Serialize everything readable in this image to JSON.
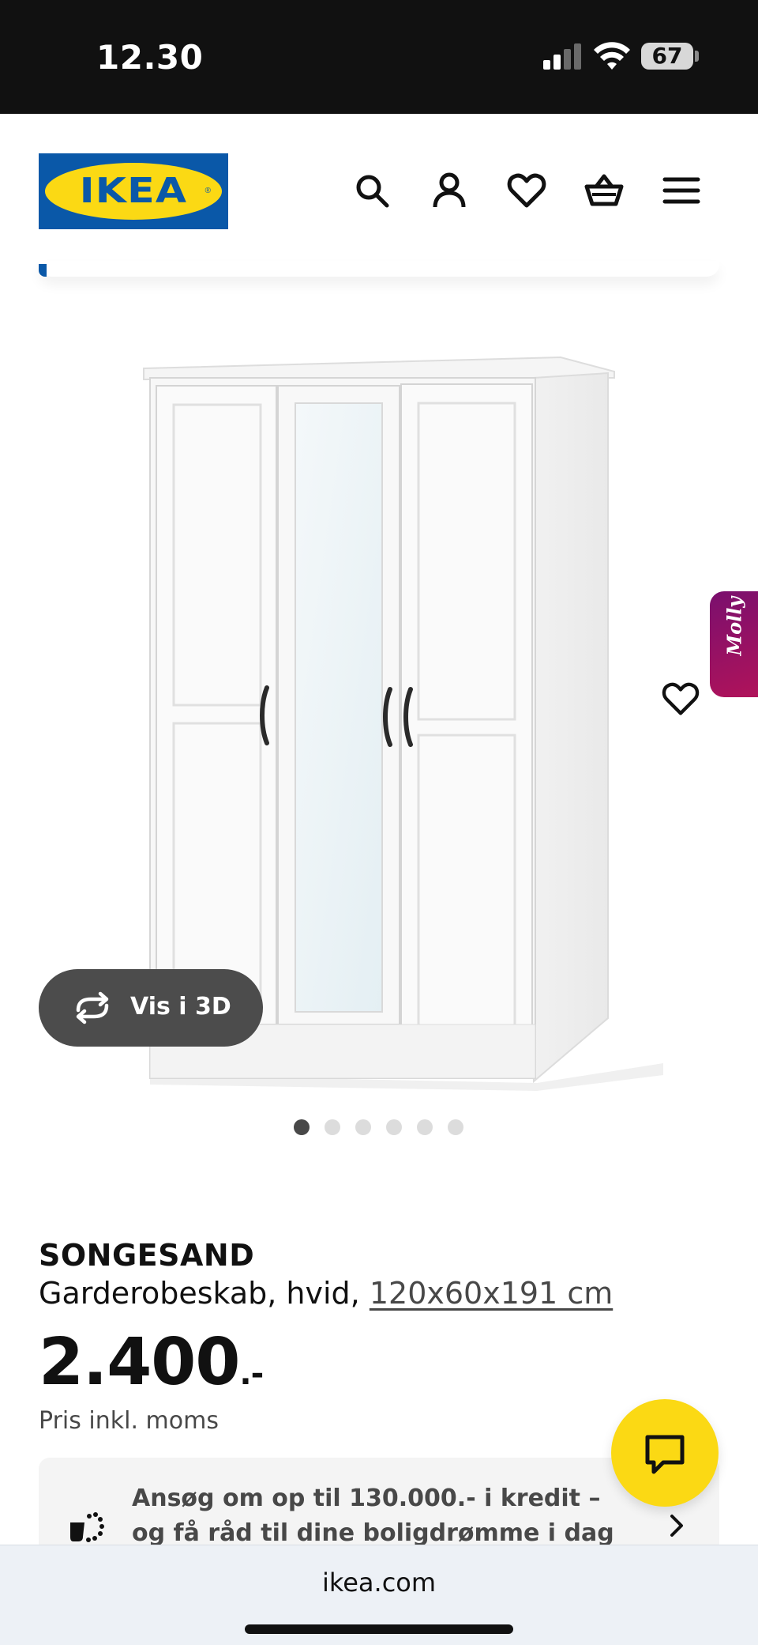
{
  "status_bar": {
    "time": "12.30",
    "battery": "67",
    "icons": [
      "signal-icon",
      "wifi-icon",
      "battery-icon"
    ]
  },
  "header": {
    "logo_text": "IKEA",
    "icons": [
      "search-icon",
      "account-icon",
      "heart-icon",
      "basket-icon",
      "menu-icon"
    ]
  },
  "product_gallery": {
    "molly_label": "Molly",
    "view_3d_label": "Vis i 3D",
    "slide_count": 6,
    "active_slide": 1
  },
  "product": {
    "name": "SONGESAND",
    "description": "Garderobeskab, hvid, ",
    "size": "120x60x191 cm",
    "price": "2.400",
    "price_suffix": ".-",
    "price_note": "Pris inkl. moms"
  },
  "credit_banner": {
    "text": "Ansøg om op til 130.000.- i kredit – og få råd til dine boligdrømme i dag"
  },
  "browser": {
    "url": "ikea.com"
  },
  "colors": {
    "ikea_blue": "#0a58a8",
    "ikea_yellow": "#fbd914",
    "molly_gradient_start": "#7a0f6e",
    "molly_gradient_end": "#b0135a",
    "view3d_bg": "#4c4c4c"
  }
}
